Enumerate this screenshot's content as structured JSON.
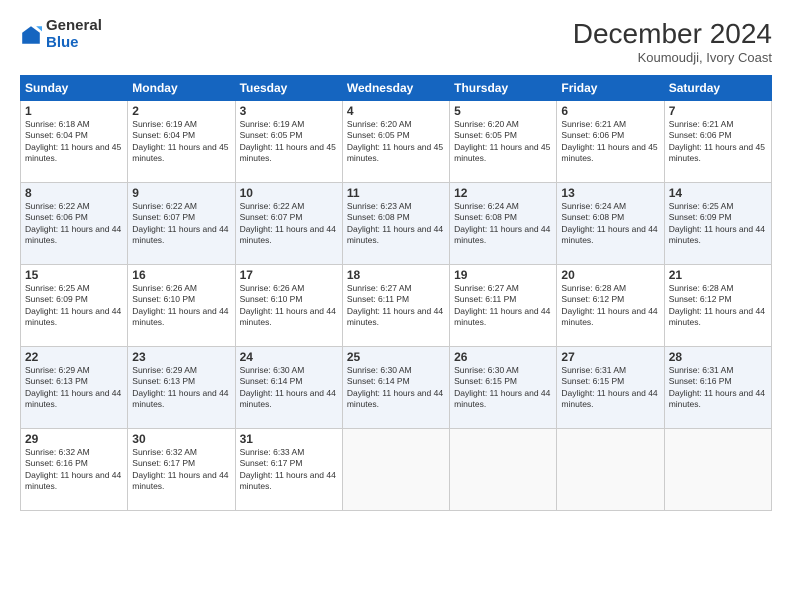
{
  "header": {
    "logo_general": "General",
    "logo_blue": "Blue",
    "month_title": "December 2024",
    "location": "Koumoudji, Ivory Coast"
  },
  "days_of_week": [
    "Sunday",
    "Monday",
    "Tuesday",
    "Wednesday",
    "Thursday",
    "Friday",
    "Saturday"
  ],
  "weeks": [
    [
      {
        "day": 1,
        "sunrise": "6:18 AM",
        "sunset": "6:04 PM",
        "daylight": "11 hours and 45 minutes."
      },
      {
        "day": 2,
        "sunrise": "6:19 AM",
        "sunset": "6:04 PM",
        "daylight": "11 hours and 45 minutes."
      },
      {
        "day": 3,
        "sunrise": "6:19 AM",
        "sunset": "6:05 PM",
        "daylight": "11 hours and 45 minutes."
      },
      {
        "day": 4,
        "sunrise": "6:20 AM",
        "sunset": "6:05 PM",
        "daylight": "11 hours and 45 minutes."
      },
      {
        "day": 5,
        "sunrise": "6:20 AM",
        "sunset": "6:05 PM",
        "daylight": "11 hours and 45 minutes."
      },
      {
        "day": 6,
        "sunrise": "6:21 AM",
        "sunset": "6:06 PM",
        "daylight": "11 hours and 45 minutes."
      },
      {
        "day": 7,
        "sunrise": "6:21 AM",
        "sunset": "6:06 PM",
        "daylight": "11 hours and 45 minutes."
      }
    ],
    [
      {
        "day": 8,
        "sunrise": "6:22 AM",
        "sunset": "6:06 PM",
        "daylight": "11 hours and 44 minutes."
      },
      {
        "day": 9,
        "sunrise": "6:22 AM",
        "sunset": "6:07 PM",
        "daylight": "11 hours and 44 minutes."
      },
      {
        "day": 10,
        "sunrise": "6:22 AM",
        "sunset": "6:07 PM",
        "daylight": "11 hours and 44 minutes."
      },
      {
        "day": 11,
        "sunrise": "6:23 AM",
        "sunset": "6:08 PM",
        "daylight": "11 hours and 44 minutes."
      },
      {
        "day": 12,
        "sunrise": "6:24 AM",
        "sunset": "6:08 PM",
        "daylight": "11 hours and 44 minutes."
      },
      {
        "day": 13,
        "sunrise": "6:24 AM",
        "sunset": "6:08 PM",
        "daylight": "11 hours and 44 minutes."
      },
      {
        "day": 14,
        "sunrise": "6:25 AM",
        "sunset": "6:09 PM",
        "daylight": "11 hours and 44 minutes."
      }
    ],
    [
      {
        "day": 15,
        "sunrise": "6:25 AM",
        "sunset": "6:09 PM",
        "daylight": "11 hours and 44 minutes."
      },
      {
        "day": 16,
        "sunrise": "6:26 AM",
        "sunset": "6:10 PM",
        "daylight": "11 hours and 44 minutes."
      },
      {
        "day": 17,
        "sunrise": "6:26 AM",
        "sunset": "6:10 PM",
        "daylight": "11 hours and 44 minutes."
      },
      {
        "day": 18,
        "sunrise": "6:27 AM",
        "sunset": "6:11 PM",
        "daylight": "11 hours and 44 minutes."
      },
      {
        "day": 19,
        "sunrise": "6:27 AM",
        "sunset": "6:11 PM",
        "daylight": "11 hours and 44 minutes."
      },
      {
        "day": 20,
        "sunrise": "6:28 AM",
        "sunset": "6:12 PM",
        "daylight": "11 hours and 44 minutes."
      },
      {
        "day": 21,
        "sunrise": "6:28 AM",
        "sunset": "6:12 PM",
        "daylight": "11 hours and 44 minutes."
      }
    ],
    [
      {
        "day": 22,
        "sunrise": "6:29 AM",
        "sunset": "6:13 PM",
        "daylight": "11 hours and 44 minutes."
      },
      {
        "day": 23,
        "sunrise": "6:29 AM",
        "sunset": "6:13 PM",
        "daylight": "11 hours and 44 minutes."
      },
      {
        "day": 24,
        "sunrise": "6:30 AM",
        "sunset": "6:14 PM",
        "daylight": "11 hours and 44 minutes."
      },
      {
        "day": 25,
        "sunrise": "6:30 AM",
        "sunset": "6:14 PM",
        "daylight": "11 hours and 44 minutes."
      },
      {
        "day": 26,
        "sunrise": "6:30 AM",
        "sunset": "6:15 PM",
        "daylight": "11 hours and 44 minutes."
      },
      {
        "day": 27,
        "sunrise": "6:31 AM",
        "sunset": "6:15 PM",
        "daylight": "11 hours and 44 minutes."
      },
      {
        "day": 28,
        "sunrise": "6:31 AM",
        "sunset": "6:16 PM",
        "daylight": "11 hours and 44 minutes."
      }
    ],
    [
      {
        "day": 29,
        "sunrise": "6:32 AM",
        "sunset": "6:16 PM",
        "daylight": "11 hours and 44 minutes."
      },
      {
        "day": 30,
        "sunrise": "6:32 AM",
        "sunset": "6:17 PM",
        "daylight": "11 hours and 44 minutes."
      },
      {
        "day": 31,
        "sunrise": "6:33 AM",
        "sunset": "6:17 PM",
        "daylight": "11 hours and 44 minutes."
      },
      null,
      null,
      null,
      null
    ]
  ]
}
